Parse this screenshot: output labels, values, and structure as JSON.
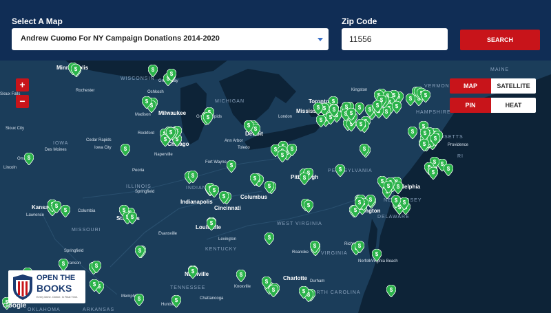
{
  "header": {
    "map_label": "Select A Map",
    "zip_label": "Zip Code",
    "selected_map": "Andrew Cuomo For NY Campaign Donations 2014-2020",
    "zip_value": "11556",
    "search_label": "SEARCH"
  },
  "map_controls": {
    "zoom_in": "+",
    "zoom_out": "−",
    "map_type": [
      "MAP",
      "SATELLITE"
    ],
    "view_mode": [
      "PIN",
      "HEAT"
    ]
  },
  "places": [
    {
      "name": "Minneapolis",
      "kind": "big"
    },
    {
      "name": "WISCONSIN",
      "kind": "state"
    },
    {
      "name": "Green Bay",
      "kind": "city"
    },
    {
      "name": "Rochester",
      "kind": "city"
    },
    {
      "name": "Oshkosh",
      "kind": "city"
    },
    {
      "name": "MICHIGAN",
      "kind": "state"
    },
    {
      "name": "Sioux Falls",
      "kind": "city"
    },
    {
      "name": "Madison",
      "kind": "city"
    },
    {
      "name": "Milwaukee",
      "kind": "big"
    },
    {
      "name": "Grand Rapids",
      "kind": "city"
    },
    {
      "name": "Detroit",
      "kind": "big"
    },
    {
      "name": "London",
      "kind": "city"
    },
    {
      "name": "Toronto",
      "kind": "big"
    },
    {
      "name": "Mississauga",
      "kind": "big"
    },
    {
      "name": "Kingston",
      "kind": "city"
    },
    {
      "name": "MAINE",
      "kind": "state"
    },
    {
      "name": "VERMONT",
      "kind": "state"
    },
    {
      "name": "HAMPSHIRE",
      "kind": "state"
    },
    {
      "name": "SSACHUSETTS",
      "kind": "state"
    },
    {
      "name": "Providence",
      "kind": "city"
    },
    {
      "name": "RI",
      "kind": "state"
    },
    {
      "name": "Sioux City",
      "kind": "city"
    },
    {
      "name": "Rockford",
      "kind": "city"
    },
    {
      "name": "Chicago",
      "kind": "big"
    },
    {
      "name": "Cedar Rapids",
      "kind": "city"
    },
    {
      "name": "Iowa City",
      "kind": "city"
    },
    {
      "name": "Des Moines",
      "kind": "city"
    },
    {
      "name": "IOWA",
      "kind": "state"
    },
    {
      "name": "Ann Arbor",
      "kind": "city"
    },
    {
      "name": "Toledo",
      "kind": "city"
    },
    {
      "name": "Naperville",
      "kind": "city"
    },
    {
      "name": "Omaha",
      "kind": "city"
    },
    {
      "name": "Lincoln",
      "kind": "city"
    },
    {
      "name": "Fort Wayne",
      "kind": "city"
    },
    {
      "name": "Peoria",
      "kind": "city"
    },
    {
      "name": "Pittsburgh",
      "kind": "big"
    },
    {
      "name": "PENNSYLVANIA",
      "kind": "state"
    },
    {
      "name": "Philadelphia",
      "kind": "big"
    },
    {
      "name": "NEW JERSEY",
      "kind": "state"
    },
    {
      "name": "DELAWARE",
      "kind": "state"
    },
    {
      "name": "ILLINOIS",
      "kind": "state"
    },
    {
      "name": "Springfield",
      "kind": "city"
    },
    {
      "name": "INDIANA",
      "kind": "state"
    },
    {
      "name": "Indianapolis",
      "kind": "big"
    },
    {
      "name": "Columbus",
      "kind": "big"
    },
    {
      "name": "Cincinnati",
      "kind": "big"
    },
    {
      "name": "Kansas City",
      "kind": "big"
    },
    {
      "name": "Lawrence",
      "kind": "city"
    },
    {
      "name": "Columbia",
      "kind": "city"
    },
    {
      "name": "St. Louis",
      "kind": "big"
    },
    {
      "name": "MISSOURI",
      "kind": "state"
    },
    {
      "name": "Louisville",
      "kind": "big"
    },
    {
      "name": "WEST VIRGINIA",
      "kind": "state"
    },
    {
      "name": "Washington",
      "kind": "big"
    },
    {
      "name": "Evansville",
      "kind": "city"
    },
    {
      "name": "Lexington",
      "kind": "city"
    },
    {
      "name": "KENTUCKY",
      "kind": "state"
    },
    {
      "name": "Springfield",
      "kind": "city"
    },
    {
      "name": "Branson",
      "kind": "city"
    },
    {
      "name": "Richmond",
      "kind": "city"
    },
    {
      "name": "Roanoke",
      "kind": "city"
    },
    {
      "name": "VIRGINIA",
      "kind": "state"
    },
    {
      "name": "Norfolk",
      "kind": "city"
    },
    {
      "name": "Virginia Beach",
      "kind": "city"
    },
    {
      "name": "Nashville",
      "kind": "big"
    },
    {
      "name": "TENNESSEE",
      "kind": "state"
    },
    {
      "name": "Charlotte",
      "kind": "big"
    },
    {
      "name": "Durham",
      "kind": "city"
    },
    {
      "name": "NORTH CAROLINA",
      "kind": "state"
    },
    {
      "name": "Memphis",
      "kind": "city"
    },
    {
      "name": "Chattanooga",
      "kind": "city"
    },
    {
      "name": "Huntsville",
      "kind": "city"
    },
    {
      "name": "Knoxville",
      "kind": "city"
    },
    {
      "name": "ARKANSAS",
      "kind": "state"
    },
    {
      "name": "OKLAHOMA",
      "kind": "state"
    }
  ],
  "logo": {
    "line1": "OPEN THE",
    "line2": "BOOKS",
    "tagline": "Every Dime. Online. In Real Time."
  },
  "attribution": "Google",
  "colors": {
    "header_bg": "#102d55",
    "accent_red": "#c8141a",
    "pin_green": "#2bb34a",
    "map_water": "#12304d",
    "map_land": "#1b3d5a"
  }
}
